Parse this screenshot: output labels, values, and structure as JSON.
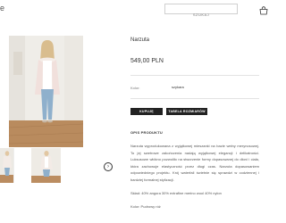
{
  "header": {
    "logo_fragment": "e",
    "search": {
      "placeholder": "SZUKAJ"
    }
  },
  "product": {
    "title": "Narzuta",
    "price": "549,00 PLN",
    "color_label": "Kolor:",
    "color_value": "szykara",
    "buy_label": "KUPUJĘ",
    "size_table_label": "TABELA ROZMIARÓW",
    "description": {
      "heading": "OPIS PRODUKTU",
      "paragraph": "Narzuta wyprodukowana z wyjątkowej mieszanki na bazie wełny merynosowej. To jej swetrowe zakończenia nadają wyjątkowej elegancji i delikatności. Luksusowe włókno pozwoliło na stworzenie formy dopasowanej do dłoni i ciała, która zachowuje elastyczność przez długi czas. Narzuta dopasowaniem odpowiedniego projektu. Krój waterfall świetnie się sprawdzi w codziennej i bardziej formalnej stylizacji.",
      "composition": "Skład: 40% angora 30% extrafine merino wool 40% nylon",
      "color_line": "Kolor: Pudrowy róż"
    }
  },
  "icons": {
    "cart": "cart-icon",
    "next": "chevron-right-icon"
  }
}
